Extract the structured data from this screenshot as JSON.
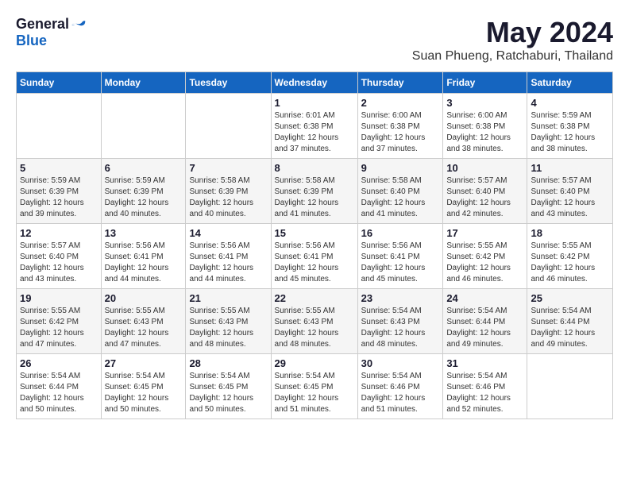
{
  "logo": {
    "general": "General",
    "blue": "Blue"
  },
  "title": "May 2024",
  "subtitle": "Suan Phueng, Ratchaburi, Thailand",
  "days_header": [
    "Sunday",
    "Monday",
    "Tuesday",
    "Wednesday",
    "Thursday",
    "Friday",
    "Saturday"
  ],
  "weeks": [
    [
      {
        "day": "",
        "info": ""
      },
      {
        "day": "",
        "info": ""
      },
      {
        "day": "",
        "info": ""
      },
      {
        "day": "1",
        "info": "Sunrise: 6:01 AM\nSunset: 6:38 PM\nDaylight: 12 hours\nand 37 minutes."
      },
      {
        "day": "2",
        "info": "Sunrise: 6:00 AM\nSunset: 6:38 PM\nDaylight: 12 hours\nand 37 minutes."
      },
      {
        "day": "3",
        "info": "Sunrise: 6:00 AM\nSunset: 6:38 PM\nDaylight: 12 hours\nand 38 minutes."
      },
      {
        "day": "4",
        "info": "Sunrise: 5:59 AM\nSunset: 6:38 PM\nDaylight: 12 hours\nand 38 minutes."
      }
    ],
    [
      {
        "day": "5",
        "info": "Sunrise: 5:59 AM\nSunset: 6:39 PM\nDaylight: 12 hours\nand 39 minutes."
      },
      {
        "day": "6",
        "info": "Sunrise: 5:59 AM\nSunset: 6:39 PM\nDaylight: 12 hours\nand 40 minutes."
      },
      {
        "day": "7",
        "info": "Sunrise: 5:58 AM\nSunset: 6:39 PM\nDaylight: 12 hours\nand 40 minutes."
      },
      {
        "day": "8",
        "info": "Sunrise: 5:58 AM\nSunset: 6:39 PM\nDaylight: 12 hours\nand 41 minutes."
      },
      {
        "day": "9",
        "info": "Sunrise: 5:58 AM\nSunset: 6:40 PM\nDaylight: 12 hours\nand 41 minutes."
      },
      {
        "day": "10",
        "info": "Sunrise: 5:57 AM\nSunset: 6:40 PM\nDaylight: 12 hours\nand 42 minutes."
      },
      {
        "day": "11",
        "info": "Sunrise: 5:57 AM\nSunset: 6:40 PM\nDaylight: 12 hours\nand 43 minutes."
      }
    ],
    [
      {
        "day": "12",
        "info": "Sunrise: 5:57 AM\nSunset: 6:40 PM\nDaylight: 12 hours\nand 43 minutes."
      },
      {
        "day": "13",
        "info": "Sunrise: 5:56 AM\nSunset: 6:41 PM\nDaylight: 12 hours\nand 44 minutes."
      },
      {
        "day": "14",
        "info": "Sunrise: 5:56 AM\nSunset: 6:41 PM\nDaylight: 12 hours\nand 44 minutes."
      },
      {
        "day": "15",
        "info": "Sunrise: 5:56 AM\nSunset: 6:41 PM\nDaylight: 12 hours\nand 45 minutes."
      },
      {
        "day": "16",
        "info": "Sunrise: 5:56 AM\nSunset: 6:41 PM\nDaylight: 12 hours\nand 45 minutes."
      },
      {
        "day": "17",
        "info": "Sunrise: 5:55 AM\nSunset: 6:42 PM\nDaylight: 12 hours\nand 46 minutes."
      },
      {
        "day": "18",
        "info": "Sunrise: 5:55 AM\nSunset: 6:42 PM\nDaylight: 12 hours\nand 46 minutes."
      }
    ],
    [
      {
        "day": "19",
        "info": "Sunrise: 5:55 AM\nSunset: 6:42 PM\nDaylight: 12 hours\nand 47 minutes."
      },
      {
        "day": "20",
        "info": "Sunrise: 5:55 AM\nSunset: 6:43 PM\nDaylight: 12 hours\nand 47 minutes."
      },
      {
        "day": "21",
        "info": "Sunrise: 5:55 AM\nSunset: 6:43 PM\nDaylight: 12 hours\nand 48 minutes."
      },
      {
        "day": "22",
        "info": "Sunrise: 5:55 AM\nSunset: 6:43 PM\nDaylight: 12 hours\nand 48 minutes."
      },
      {
        "day": "23",
        "info": "Sunrise: 5:54 AM\nSunset: 6:43 PM\nDaylight: 12 hours\nand 48 minutes."
      },
      {
        "day": "24",
        "info": "Sunrise: 5:54 AM\nSunset: 6:44 PM\nDaylight: 12 hours\nand 49 minutes."
      },
      {
        "day": "25",
        "info": "Sunrise: 5:54 AM\nSunset: 6:44 PM\nDaylight: 12 hours\nand 49 minutes."
      }
    ],
    [
      {
        "day": "26",
        "info": "Sunrise: 5:54 AM\nSunset: 6:44 PM\nDaylight: 12 hours\nand 50 minutes."
      },
      {
        "day": "27",
        "info": "Sunrise: 5:54 AM\nSunset: 6:45 PM\nDaylight: 12 hours\nand 50 minutes."
      },
      {
        "day": "28",
        "info": "Sunrise: 5:54 AM\nSunset: 6:45 PM\nDaylight: 12 hours\nand 50 minutes."
      },
      {
        "day": "29",
        "info": "Sunrise: 5:54 AM\nSunset: 6:45 PM\nDaylight: 12 hours\nand 51 minutes."
      },
      {
        "day": "30",
        "info": "Sunrise: 5:54 AM\nSunset: 6:46 PM\nDaylight: 12 hours\nand 51 minutes."
      },
      {
        "day": "31",
        "info": "Sunrise: 5:54 AM\nSunset: 6:46 PM\nDaylight: 12 hours\nand 52 minutes."
      },
      {
        "day": "",
        "info": ""
      }
    ]
  ]
}
